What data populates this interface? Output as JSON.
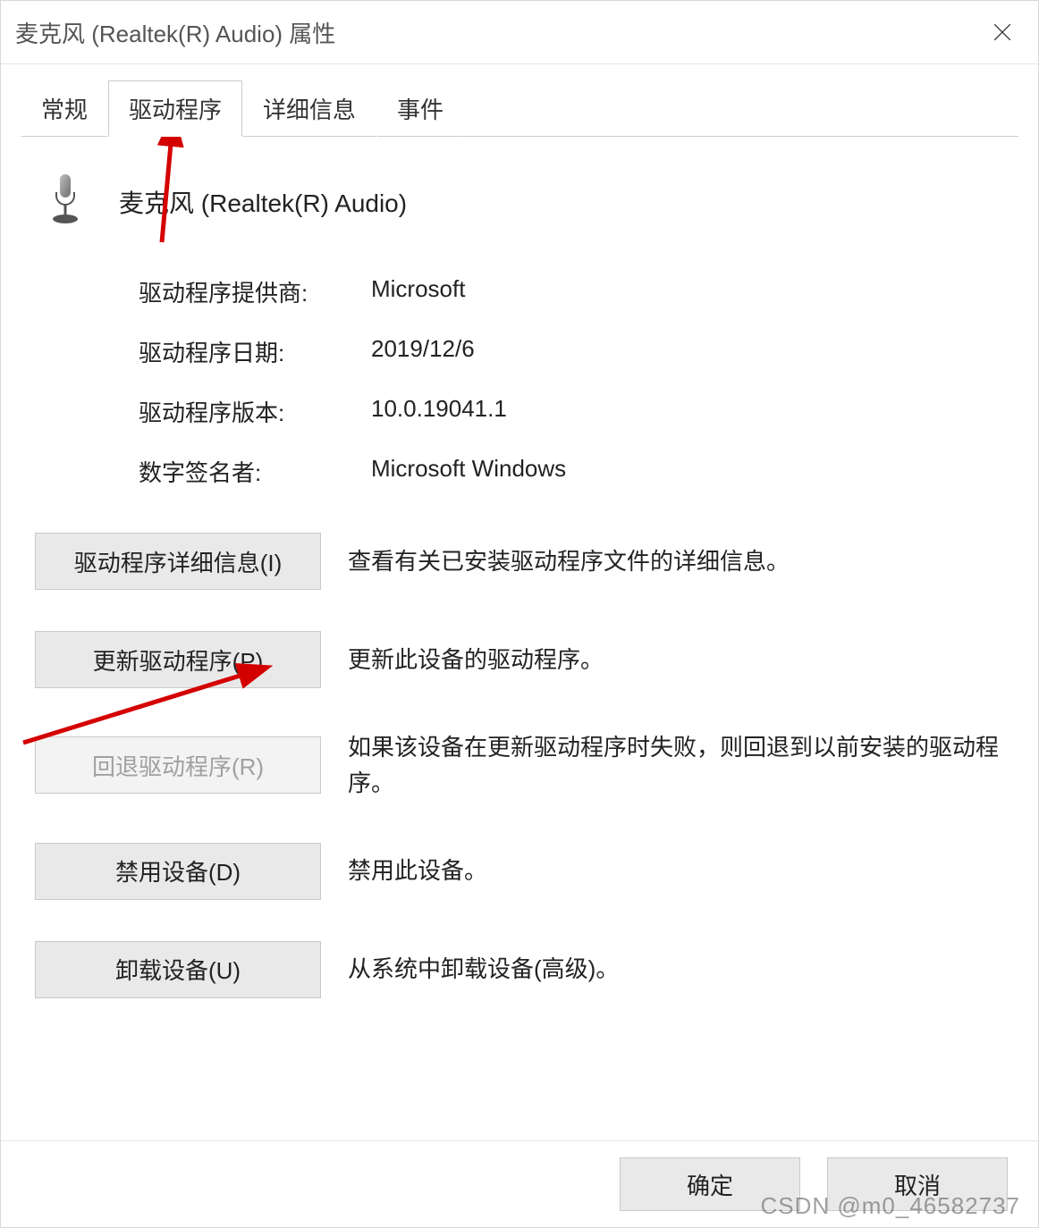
{
  "window": {
    "title": "麦克风 (Realtek(R) Audio) 属性"
  },
  "tabs": {
    "general": "常规",
    "driver": "驱动程序",
    "details": "详细信息",
    "events": "事件"
  },
  "device": {
    "name": "麦克风 (Realtek(R) Audio)"
  },
  "props": {
    "provider_label": "驱动程序提供商:",
    "provider_value": "Microsoft",
    "date_label": "驱动程序日期:",
    "date_value": "2019/12/6",
    "version_label": "驱动程序版本:",
    "version_value": "10.0.19041.1",
    "signer_label": "数字签名者:",
    "signer_value": "Microsoft Windows"
  },
  "actions": {
    "details_btn": "驱动程序详细信息(I)",
    "details_desc": "查看有关已安装驱动程序文件的详细信息。",
    "update_btn": "更新驱动程序(P)",
    "update_desc": "更新此设备的驱动程序。",
    "rollback_btn": "回退驱动程序(R)",
    "rollback_desc": "如果该设备在更新驱动程序时失败，则回退到以前安装的驱动程序。",
    "disable_btn": "禁用设备(D)",
    "disable_desc": "禁用此设备。",
    "uninstall_btn": "卸载设备(U)",
    "uninstall_desc": "从系统中卸载设备(高级)。"
  },
  "footer": {
    "ok": "确定",
    "cancel": "取消"
  },
  "watermark": "CSDN @m0_46582737"
}
